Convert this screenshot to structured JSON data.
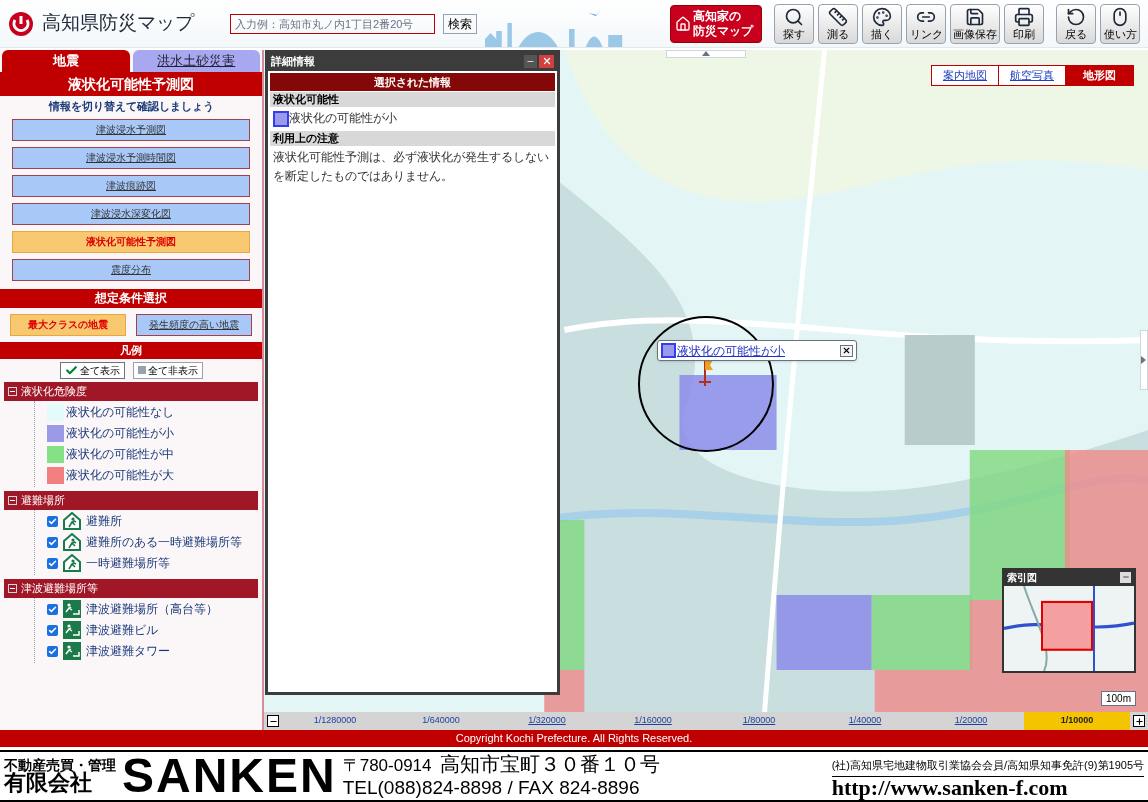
{
  "header": {
    "title": "高知県防災マップ",
    "search": {
      "placeholder": "入力例：高知市丸ノ内1丁目2番20号",
      "button": "検索"
    },
    "brand_button": [
      "高知家の",
      "防災マップ"
    ],
    "tools": [
      {
        "label": "探す",
        "kind": "search"
      },
      {
        "label": "測る",
        "kind": "measure"
      },
      {
        "label": "描く",
        "kind": "draw"
      },
      {
        "label": "リンク",
        "kind": "link"
      },
      {
        "label": "画像保存",
        "kind": "save"
      },
      {
        "label": "印刷",
        "kind": "print"
      },
      {
        "label": "戻る",
        "kind": "back"
      },
      {
        "label": "使い方",
        "kind": "help"
      }
    ]
  },
  "tabs": [
    {
      "label": "地震",
      "selected": true
    },
    {
      "label": "洪水土砂災害",
      "selected": false
    }
  ],
  "sidebar": {
    "title": "液状化可能性予測図",
    "subtitle": "情報を切り替えて確認しましょう",
    "map_buttons": [
      {
        "label": "津波浸水予測図",
        "selected": false
      },
      {
        "label": "津波浸水予測時間図",
        "selected": false
      },
      {
        "label": "津波痕跡図",
        "selected": false
      },
      {
        "label": "津波浸水深変化図",
        "selected": false
      },
      {
        "label": "液状化可能性予測図",
        "selected": true
      },
      {
        "label": "震度分布",
        "selected": false
      }
    ],
    "condition_title": "想定条件選択",
    "conditions": [
      {
        "label": "最大クラスの地震",
        "selected": true
      },
      {
        "label": "発生頻度の高い地震",
        "selected": false
      }
    ],
    "legend": {
      "title": "凡例",
      "show_all": "全て表示",
      "hide_all": "全て非表示",
      "groups": [
        {
          "label": "液状化危険度",
          "expanded": true,
          "items": [
            {
              "kind": "swatch",
              "label": "液状化の可能性なし",
              "color": "#e4fbfb"
            },
            {
              "kind": "swatch",
              "label": "液状化の可能性が小",
              "color": "#9a9ae8"
            },
            {
              "kind": "swatch",
              "label": "液状化の可能性が中",
              "color": "#86e086"
            },
            {
              "kind": "swatch",
              "label": "液状化の可能性が大",
              "color": "#f28080"
            }
          ]
        },
        {
          "label": "避難場所",
          "expanded": true,
          "items": [
            {
              "kind": "checkbox",
              "label": "避難所",
              "checked": true
            },
            {
              "kind": "checkbox",
              "label": "避難所のある一時避難場所等",
              "checked": true
            },
            {
              "kind": "checkbox",
              "label": "一時避難場所等",
              "checked": true
            }
          ]
        },
        {
          "label": "津波避難場所等",
          "expanded": true,
          "items": [
            {
              "kind": "checkbox",
              "label": "津波避難場所（高台等）",
              "checked": true
            },
            {
              "kind": "checkbox",
              "label": "津波避難ビル",
              "checked": true
            },
            {
              "kind": "checkbox",
              "label": "津波避難タワー",
              "checked": true
            }
          ]
        }
      ]
    }
  },
  "detail_panel": {
    "title": "詳細情報",
    "header": "選択された情報",
    "sections": [
      {
        "label": "液状化可能性",
        "value": "液状化の可能性が小",
        "color": "#9a9ae8"
      },
      {
        "label": "利用上の注意",
        "value": "液状化可能性予測は、必ず液状化が発生するしないを断定したものではありません。"
      }
    ]
  },
  "map": {
    "map_types": [
      {
        "label": "案内地図",
        "selected": false
      },
      {
        "label": "航空写真",
        "selected": false
      },
      {
        "label": "地形図",
        "selected": true
      }
    ],
    "popup": {
      "label": "液状化の可能性が小",
      "color": "#9a9ae8"
    },
    "index_map": {
      "title": "索引図"
    },
    "scale_label": "100m",
    "scales": [
      {
        "label": "1/1280000",
        "selected": false
      },
      {
        "label": "1/640000",
        "selected": false
      },
      {
        "label": "1/320000",
        "selected": false
      },
      {
        "label": "1/160000",
        "selected": false
      },
      {
        "label": "1/80000",
        "selected": false
      },
      {
        "label": "1/40000",
        "selected": false
      },
      {
        "label": "1/20000",
        "selected": false
      },
      {
        "label": "1/10000",
        "selected": true
      }
    ]
  },
  "copyright": "Copyright Kochi Prefecture. All Rights Reserved.",
  "advert": {
    "tagline": "不動産売買・管理",
    "company_type": "有限会社",
    "company": "SANKEN",
    "postal": "〒780-0914",
    "address": "高知市宝町３０番１０号",
    "phone": "TEL(088)824-8898 / FAX 824-8896",
    "license": "(社)高知県宅地建物取引業協会会員/高知県知事免許(9)第1905号",
    "url": "http://www.sanken-f.com"
  }
}
